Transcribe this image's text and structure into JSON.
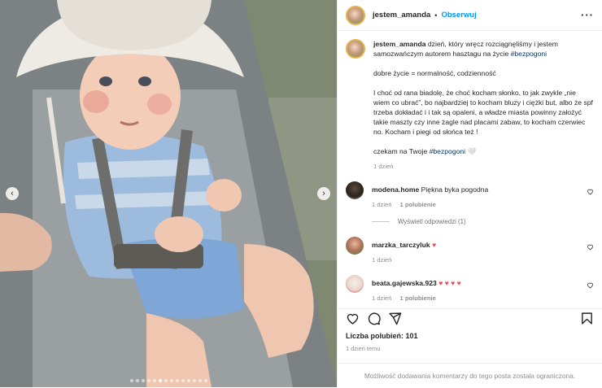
{
  "post": {
    "username": "jestem_amanda",
    "follow_label": "Obserwuj",
    "separator": "•",
    "more_label": "···"
  },
  "caption": {
    "username": "jestem_amanda",
    "line1": "dzień, który wręcz rozciągnęliśmy i jestem samozwańczym autorem hasztagu na życie ",
    "tag1": "#bezpogoni",
    "para2": "dobre życie = normalność, codzienność",
    "para3": "I choć od rana biadolę, że choć kocham słonko, to jak zwykle „nie wiem co ubrać”, bo najbardziej to kocham bluzy i ciężki but, albo że spf trzeba dokładać i i tak są opaleni, a władze miasta powinny założyć takie maszty czy inne żagle nad placami zabaw, to kocham czerwiec no. Kocham i piegi od słońca też !",
    "para4": "czekam na Twoje ",
    "tag2": "#bezpogoni",
    "tag2_emoji": "🤍",
    "time": "1 dzień"
  },
  "comments": [
    {
      "username": "modena.home",
      "text": "Piękna byka pogodna",
      "time": "1 dzień",
      "likes": "1 polubienie",
      "reply_label": ""
    },
    {
      "username": "marzka_tarczyluk",
      "text": "♥",
      "time": "1 dzień",
      "likes": "",
      "reply_label": ""
    },
    {
      "username": "beata.gajewska.923",
      "text": "♥ ♥ ♥ ♥",
      "time": "1 dzień",
      "likes": "1 polubienie",
      "reply_label": ""
    }
  ],
  "view_replies": "Wyświetl odpowiedzi (1)",
  "likes_label": "Liczba polubień: 101",
  "posted_ago": "1 dzień temu",
  "comments_restricted": "Możliwość dodawania komentarzy do tego posta została ograniczona.",
  "carousel": {
    "total_slides": 14,
    "active_index": 5
  },
  "colors": {
    "accent": "#0095f6",
    "tag": "#00376b",
    "muted": "#8e8e8e",
    "heart": "#ed4956"
  },
  "icons": [
    "heart-icon",
    "comment-icon",
    "share-icon",
    "bookmark-icon",
    "chevron-left-icon",
    "chevron-right-icon",
    "more-icon"
  ]
}
